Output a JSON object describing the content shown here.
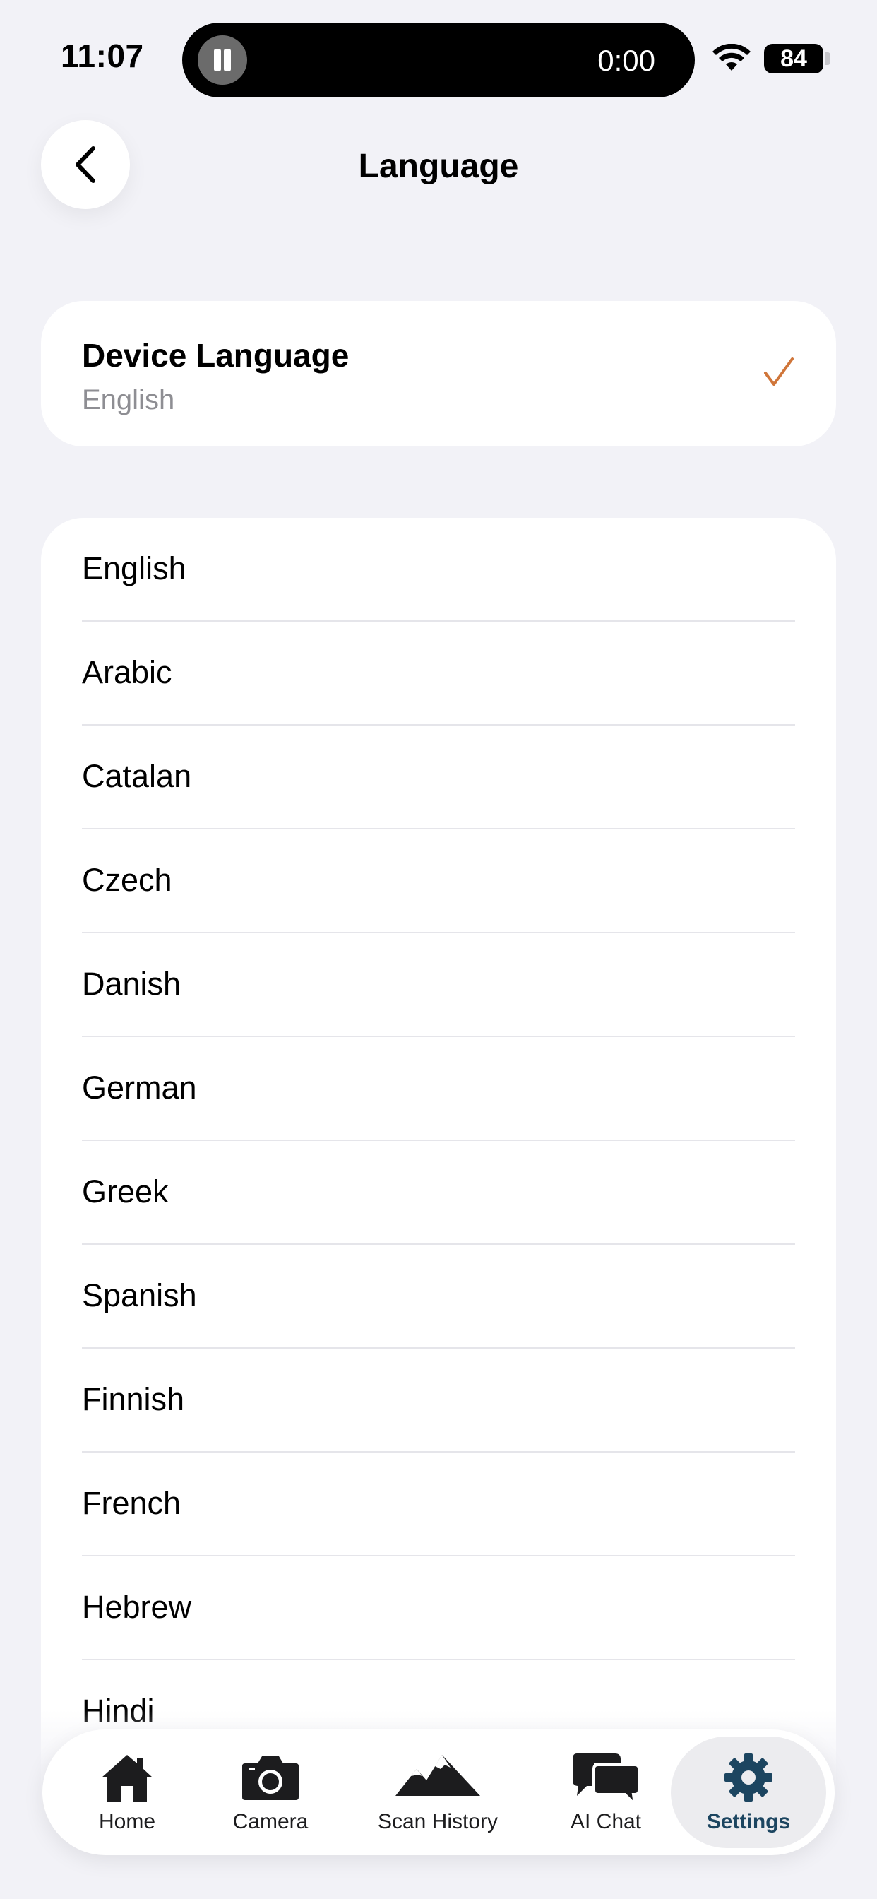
{
  "status_bar": {
    "time": "11:07",
    "island_timer": "0:00",
    "battery": "84"
  },
  "header": {
    "title": "Language"
  },
  "device_language": {
    "title": "Device Language",
    "value": "English"
  },
  "languages": [
    "English",
    "Arabic",
    "Catalan",
    "Czech",
    "Danish",
    "German",
    "Greek",
    "Spanish",
    "Finnish",
    "French",
    "Hebrew",
    "Hindi"
  ],
  "tab_bar": {
    "home": "Home",
    "camera": "Camera",
    "scan_history": "Scan History",
    "ai_chat": "AI Chat",
    "settings": "Settings"
  },
  "colors": {
    "accent_check": "#d0763a",
    "active_tab": "#1c4560"
  }
}
